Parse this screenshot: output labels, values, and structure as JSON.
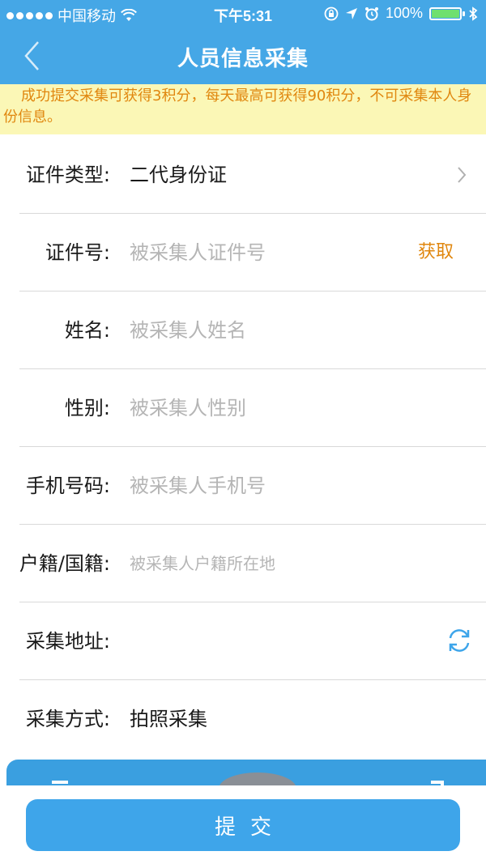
{
  "status_bar": {
    "carrier": "中国移动",
    "time": "下午5:31",
    "battery": "100%",
    "battery_level": 1.0,
    "icons": [
      "signal-icon",
      "wifi-icon",
      "rotation-lock-icon",
      "location-icon",
      "alarm-icon",
      "battery-icon",
      "bluetooth-icon"
    ]
  },
  "nav": {
    "title": "人员信息采集",
    "back_icon": "chevron-left-icon"
  },
  "notice": {
    "text": "成功提交采集可获得3积分，每天最高可获得90积分，不可采集本人身份信息。"
  },
  "form": {
    "id_type": {
      "label": "证件类型:",
      "value": "二代身份证"
    },
    "id_number": {
      "label": "证件号:",
      "placeholder": "被采集人证件号",
      "action": "获取"
    },
    "name": {
      "label": "姓名:",
      "placeholder": "被采集人姓名"
    },
    "gender": {
      "label": "性别:",
      "placeholder": "被采集人性别"
    },
    "phone": {
      "label": "手机号码:",
      "placeholder": "被采集人手机号"
    },
    "household": {
      "label": "户籍/国籍:",
      "placeholder": "被采集人户籍所在地"
    },
    "address": {
      "label": "采集地址:"
    },
    "method": {
      "label": "采集方式:",
      "value": "拍照采集"
    }
  },
  "submit": {
    "label": "提交"
  },
  "colors": {
    "primary": "#45a7e6",
    "notice_bg": "#fbf7b6",
    "notice_text": "#e0870f",
    "accent": "#e0870f",
    "placeholder": "#b5b5b5"
  }
}
